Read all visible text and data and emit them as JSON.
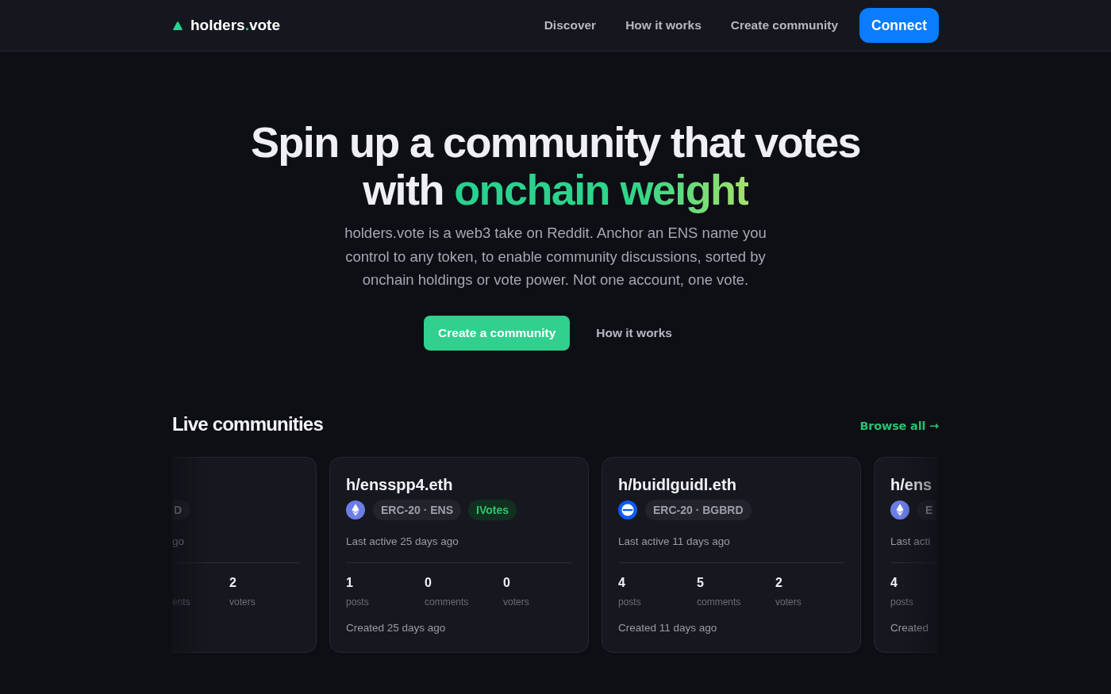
{
  "header": {
    "logo": {
      "text": "holders",
      "accent": ".",
      "suffix": "vote"
    },
    "nav": [
      "Discover",
      "How it works",
      "Create community"
    ],
    "connect": "Connect"
  },
  "hero": {
    "title": {
      "text": "Spin up a community that votes with",
      "highlight": "onchain weight"
    },
    "description": "holders.vote is a web3 take on Reddit. Anchor an ENS name you control to any token, to enable community discussions, sorted by onchain holdings or vote power. Not one account, one vote.",
    "primary_action": "Create a community",
    "secondary_action": "How it works"
  },
  "live_communities": {
    "title": "Live communities",
    "browse_all": "Browse all →",
    "cards": [
      {
        "kind": "clipped_left",
        "tags": [
          {
            "text": "D",
            "kind": "neutral"
          }
        ],
        "last_active": "go",
        "stats": [
          {
            "label": "ents"
          },
          {
            "value": "2",
            "label": "voters"
          }
        ]
      },
      {
        "kind": "full",
        "name": "h/ensspp4.eth",
        "token": {
          "kind": "diamond"
        },
        "tags": [
          {
            "text": "ERC-20 · ENS",
            "kind": "neutral"
          },
          {
            "text": "IVotes",
            "kind": "votes"
          }
        ],
        "last_active": "Last active 25 days ago",
        "stats": [
          {
            "value": "1",
            "label": "posts"
          },
          {
            "value": "0",
            "label": "comments"
          },
          {
            "value": "0",
            "label": "voters"
          }
        ],
        "created": "Created 25 days ago"
      },
      {
        "kind": "full",
        "name": "h/buidlguidl.eth",
        "token": {
          "kind": "striped"
        },
        "tags": [
          {
            "text": "ERC-20 · BGBRD",
            "kind": "neutral"
          }
        ],
        "last_active": "Last active 11 days ago",
        "stats": [
          {
            "value": "4",
            "label": "posts"
          },
          {
            "value": "5",
            "label": "comments"
          },
          {
            "value": "2",
            "label": "voters"
          }
        ],
        "created": "Created 11 days ago"
      },
      {
        "kind": "clipped_right",
        "name": "h/ens",
        "token": {
          "kind": "diamond"
        },
        "tags": [
          {
            "text": "E",
            "kind": "neutral"
          }
        ],
        "last_active": "Last acti",
        "stats": [
          {
            "value": "4",
            "label": "posts"
          }
        ],
        "created": "Created"
      }
    ]
  }
}
